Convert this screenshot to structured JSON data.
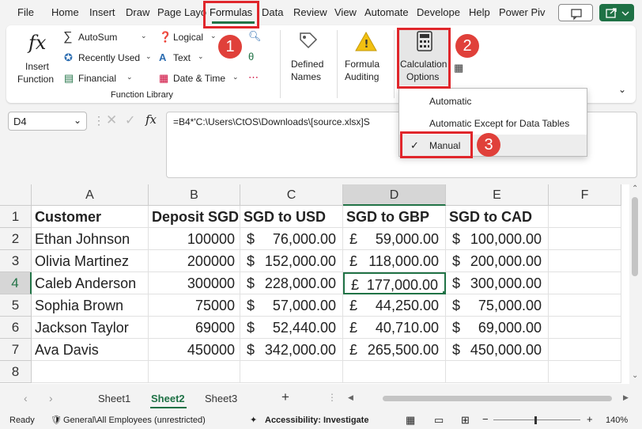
{
  "menu": {
    "tabs": [
      "File",
      "Home",
      "Insert",
      "Draw",
      "Page Layo",
      "Formulas",
      "Data",
      "Review",
      "View",
      "Automate",
      "Develope",
      "Help",
      "Power Piv"
    ],
    "active_tab": "Formulas"
  },
  "ribbon": {
    "insert_function": [
      "Insert",
      "Function"
    ],
    "autosum": "AutoSum",
    "recently_used": "Recently Used",
    "financial": "Financial",
    "logical": "Logical",
    "text": "Text",
    "date_time": "Date & Time",
    "group_label": "Function Library",
    "defined_names": [
      "Defined",
      "Names"
    ],
    "formula_auditing": [
      "Formula",
      "Auditing"
    ],
    "calc_options": [
      "Calculation",
      "Options"
    ]
  },
  "calc_menu": {
    "items": [
      "Automatic",
      "Automatic Except for Data Tables",
      "Manual"
    ],
    "checked": "Manual"
  },
  "formula_bar": {
    "name_box": "D4",
    "fx": "fx",
    "formula": "=B4*'C:\\Users\\CtOS\\Downloads\\[source.xlsx]S"
  },
  "grid": {
    "columns": [
      "A",
      "B",
      "C",
      "D",
      "E",
      "F"
    ],
    "rows": [
      "1",
      "2",
      "3",
      "4",
      "5",
      "6",
      "7",
      "8"
    ],
    "headers": [
      "Customer",
      "Deposit SGD",
      "SGD to USD",
      "SGD to GBP",
      "SGD to CAD"
    ],
    "data": [
      [
        "Ethan Johnson",
        "100000",
        [
          "$",
          "76,000.00"
        ],
        [
          "£",
          "59,000.00"
        ],
        [
          "$",
          "100,000.00"
        ]
      ],
      [
        "Olivia Martinez",
        "200000",
        [
          "$",
          "152,000.00"
        ],
        [
          "£",
          "118,000.00"
        ],
        [
          "$",
          "200,000.00"
        ]
      ],
      [
        "Caleb Anderson",
        "300000",
        [
          "$",
          "228,000.00"
        ],
        [
          "£",
          "177,000.00"
        ],
        [
          "$",
          "300,000.00"
        ]
      ],
      [
        "Sophia Brown",
        "75000",
        [
          "$",
          "57,000.00"
        ],
        [
          "£",
          "44,250.00"
        ],
        [
          "$",
          "75,000.00"
        ]
      ],
      [
        "Jackson Taylor",
        "69000",
        [
          "$",
          "52,440.00"
        ],
        [
          "£",
          "40,710.00"
        ],
        [
          "$",
          "69,000.00"
        ]
      ],
      [
        "Ava Davis",
        "450000",
        [
          "$",
          "342,000.00"
        ],
        [
          "£",
          "265,500.00"
        ],
        [
          "$",
          "450,000.00"
        ]
      ]
    ],
    "selected_cell": "D4"
  },
  "sheets": {
    "tabs": [
      "Sheet1",
      "Sheet2",
      "Sheet3"
    ],
    "active": "Sheet2",
    "add": "+"
  },
  "status": {
    "ready": "Ready",
    "sensitivity": "General\\All Employees (unrestricted)",
    "accessibility": "Accessibility: Investigate",
    "zoom": "140%"
  },
  "annotations": [
    "1",
    "2",
    "3"
  ],
  "colors": {
    "accent": "#217346",
    "annotation": "#e0262b"
  }
}
